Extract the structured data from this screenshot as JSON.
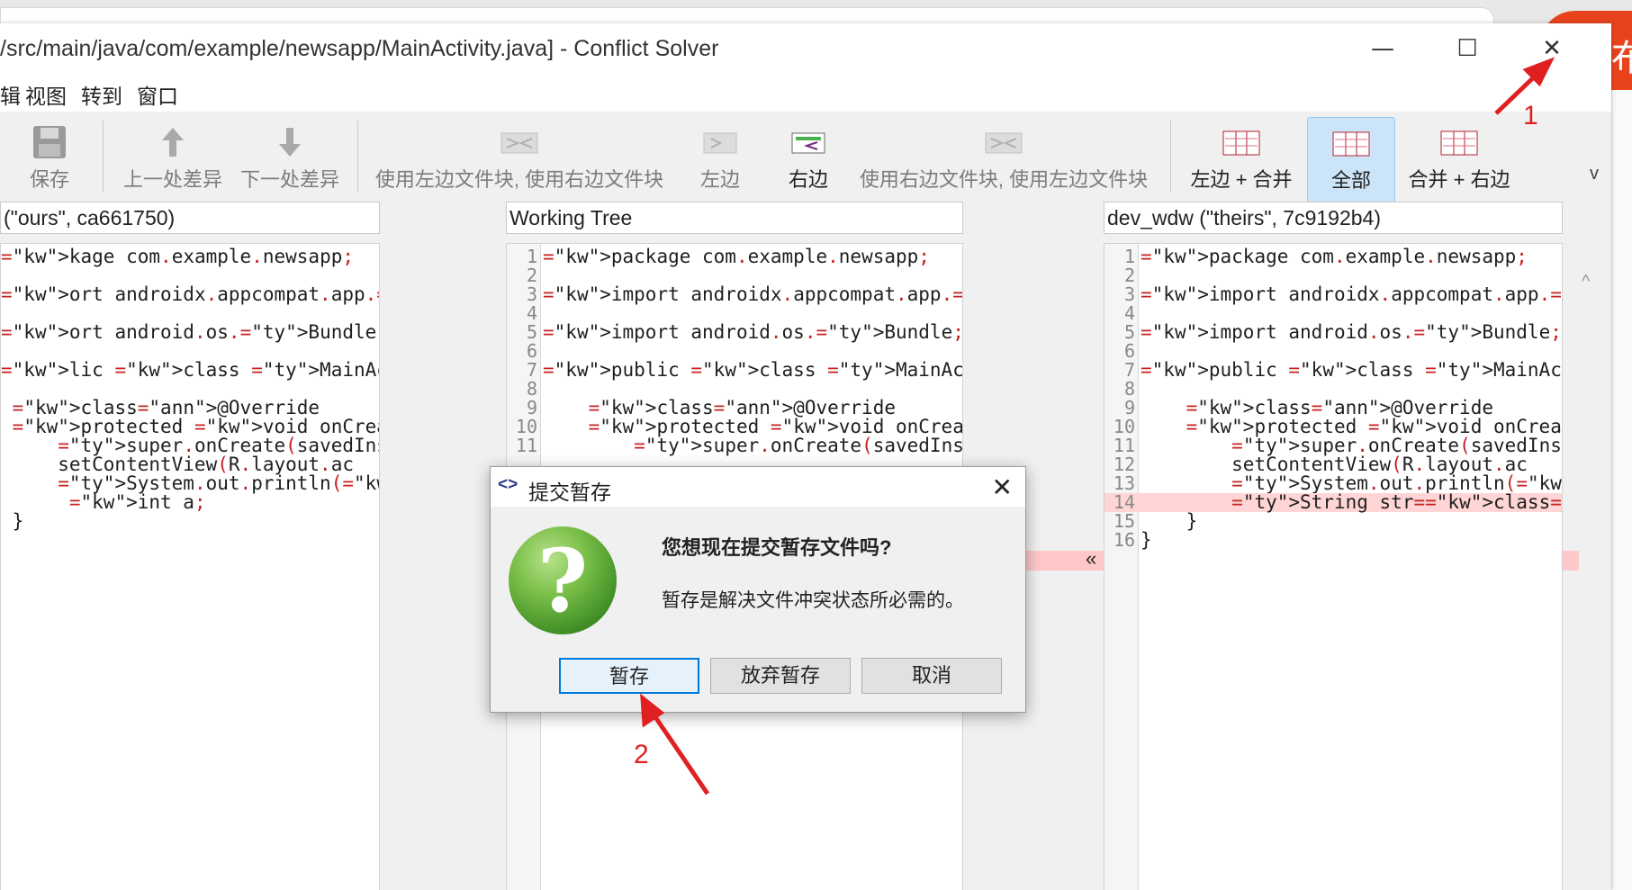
{
  "window": {
    "title": "/src/main/java/com/example/newsapp/MainActivity.java] - Conflict Solver",
    "controls": {
      "minimize": "—",
      "maximize": "☐",
      "close": "✕"
    }
  },
  "menu": {
    "items": [
      "辑",
      "视图",
      "转到",
      "窗口"
    ]
  },
  "toolbar": {
    "save": "保存",
    "prev_diff": "上一处差异",
    "next_diff": "下一处差异",
    "use_left_then_right": "使用左边文件块, 使用右边文件块",
    "left": "左边",
    "right": "右边",
    "use_right_then_left": "使用右边文件块, 使用左边文件块",
    "left_merge": "左边 + 合并",
    "all": "全部",
    "merge_right": "合并 + 右边",
    "overflow": "v"
  },
  "panes": {
    "left": {
      "header": "(\"ours\", ca661750)"
    },
    "middle": {
      "header": "Working Tree"
    },
    "right": {
      "header": "dev_wdw (\"theirs\", 7c9192b4)"
    }
  },
  "code": {
    "left_lines": [
      "kage com.example.newsapp;",
      "",
      "ort androidx.appcompat.app.AppC",
      "",
      "ort android.os.Bundle;",
      "",
      "lic class MainActivity extends",
      "",
      " @Override",
      " protected void onCreate(Bundle",
      "     super.onCreate(savedInstar",
      "     setContentView(R.layout.ac",
      "     System.out.println(\"测试合并",
      "      int a;",
      " }"
    ],
    "middle_lines": [
      "package com.example.newsapp;",
      "",
      "import androidx.appcompat.app.AppC",
      "",
      "import android.os.Bundle;",
      "",
      "public class MainActivity extends",
      "",
      "    @Override",
      "    protected void onCreate(Bundle",
      "        super.onCreate(savedInsta"
    ],
    "right_lines": [
      "package com.example.newsapp;",
      "",
      "import androidx.appcompat.app.AppC",
      "",
      "import android.os.Bundle;",
      "",
      "public class MainActivity extends",
      "",
      "    @Override",
      "    protected void onCreate(Bundle",
      "        super.onCreate(savedInstar",
      "        setContentView(R.layout.ac",
      "        System.out.println(\"测试合并",
      "        String str=\"abc\";",
      "    }",
      "}"
    ],
    "line_numbers": [
      "1",
      "2",
      "3",
      "4",
      "5",
      "6",
      "7",
      "8",
      "9",
      "10",
      "11",
      "12",
      "13",
      "14",
      "15",
      "16"
    ],
    "conflict_marker": "«"
  },
  "dialog": {
    "title": "提交暂存",
    "title_icon": "<>",
    "close": "✕",
    "icon": "?",
    "heading": "您想现在提交暂存文件吗?",
    "message": "暂存是解决文件冲突状态所必需的。",
    "buttons": {
      "stage": "暂存",
      "discard": "放弃暂存",
      "cancel": "取消"
    }
  },
  "annotations": {
    "one": "1",
    "two": "2"
  },
  "background": {
    "orange_text": "布"
  },
  "colors": {
    "accent": "#0078d7",
    "conflict": "#ffd5d5",
    "annotation": "#e02020",
    "selected": "#cce4f7"
  }
}
